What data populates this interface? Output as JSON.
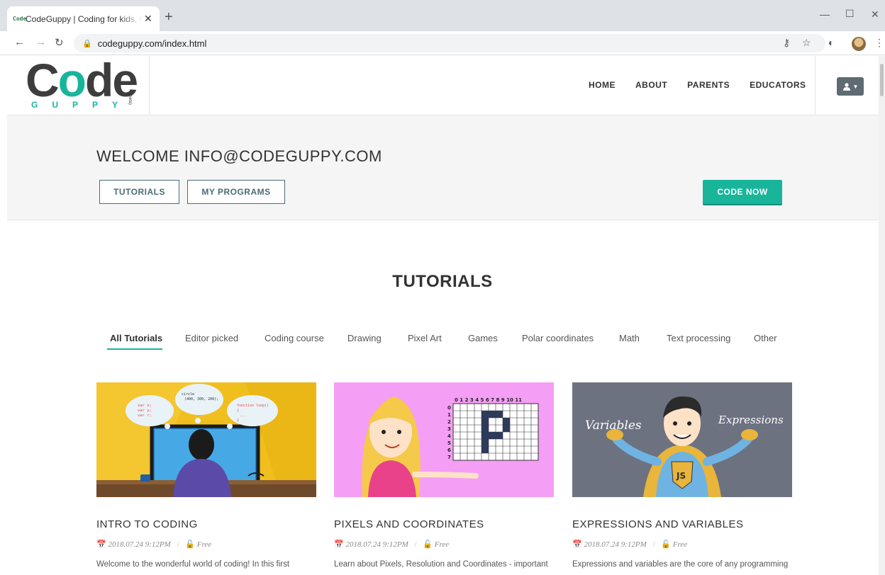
{
  "browser": {
    "tab_title": "CodeGuppy | Coding for kids, teens and adults",
    "tab_favicon": "Code",
    "new_tab": "+",
    "close": "✕",
    "url": "codeguppy.com/index.html",
    "min": "—",
    "max": "☐",
    "winclose": "✕"
  },
  "logo": {
    "word_c": "C",
    "word_o": "o",
    "word_de": "de",
    "sub": "GUPPY",
    "beta": "(beta)"
  },
  "nav": {
    "home": "HOME",
    "about": "ABOUT",
    "parents": "PARENTS",
    "educators": "EDUCATORS"
  },
  "welcome": {
    "title": "WELCOME INFO@CODEGUPPY.COM",
    "tutorials_btn": "TUTORIALS",
    "programs_btn": "MY PROGRAMS",
    "code_now_btn": "CODE NOW"
  },
  "tutorials": {
    "title": "TUTORIALS",
    "filters": [
      "All Tutorials",
      "Editor picked",
      "Coding course",
      "Drawing",
      "Pixel Art",
      "Games",
      "Polar coordinates",
      "Math",
      "Text processing",
      "Other"
    ],
    "cards": [
      {
        "title": "INTRO TO CODING",
        "date": "2018.07.24 9:12PM",
        "access": "Free",
        "desc": "Welcome to the wonderful world of coding! In this first",
        "bubble1": "var x;\nvar y;\nvar r;",
        "bubble2": "circle\n(400, 300, 200);",
        "bubble3": "function loop()\n{\n  ...\n}"
      },
      {
        "title": "PIXELS AND COORDINATES",
        "date": "2018.07.24 9:12PM",
        "access": "Free",
        "desc": "Learn about Pixels, Resolution and Coordinates - important",
        "grid_cols": "0 1 2 3 4 5 6 7 8 9 10 11",
        "grid_rows": [
          "0",
          "1",
          "2",
          "3",
          "4",
          "5",
          "6",
          "7"
        ],
        "letter": "P"
      },
      {
        "title": "EXPRESSIONS AND VARIABLES",
        "date": "2018.07.24 9:12PM",
        "access": "Free",
        "desc": "Expressions and variables are the core of any programming",
        "left_word": "Variables",
        "right_word": "Expressions",
        "badge": "JS"
      }
    ]
  },
  "colors": {
    "accent": "#18b59b",
    "outline": "#4a6d77",
    "card1_bg": "#f0bf1e",
    "card2_bg": "#f59ef5",
    "card3_bg": "#6d7280"
  }
}
